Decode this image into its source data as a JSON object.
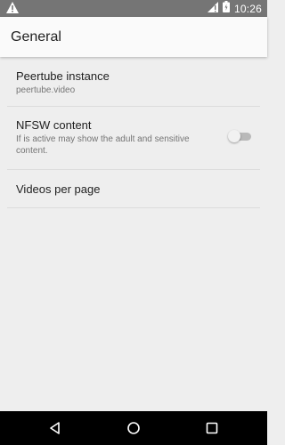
{
  "status_bar": {
    "time": "10:26",
    "icons": [
      "warning-icon",
      "signal-icon",
      "battery-icon"
    ],
    "background": "#757575"
  },
  "app_bar": {
    "title": "General"
  },
  "preferences": [
    {
      "title": "Peertube instance",
      "summary": "peertube.video"
    },
    {
      "title": "NFSW content",
      "summary": "If is active may show the adult and sensitive content.",
      "toggle_on": false
    },
    {
      "title": "Videos per page"
    }
  ],
  "nav_bar": {
    "buttons": [
      "back-icon",
      "home-icon",
      "recents-icon"
    ],
    "background": "#000000"
  }
}
